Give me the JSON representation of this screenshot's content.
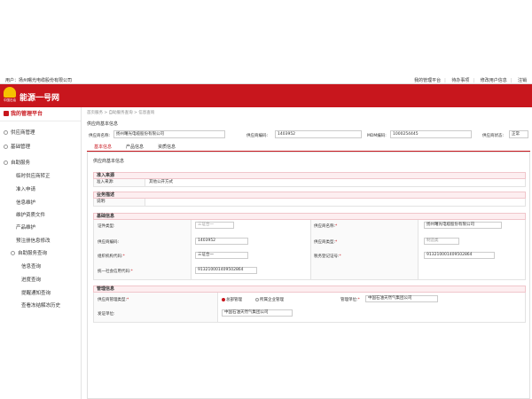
{
  "topbar": {
    "user_label": "用户：扬州曙光电缆股份有限公司",
    "links": [
      "我的管理平台",
      "待办事项",
      "修改用户信息",
      "注销"
    ]
  },
  "header": {
    "title": "能源一号网",
    "logo_caption": "中国石油"
  },
  "sidebar": {
    "title": "我的管理平台",
    "items": [
      {
        "label": "供应商管理"
      },
      {
        "label": "基础管理"
      },
      {
        "label": "自助服务"
      },
      {
        "label": "临时供应商转正"
      },
      {
        "label": "准入申请"
      },
      {
        "label": "信息维护"
      },
      {
        "label": "维护资质文件"
      },
      {
        "label": "产品维护"
      },
      {
        "label": "预注册信息修改"
      },
      {
        "label": "自助服务查询"
      },
      {
        "label": "信息查询"
      },
      {
        "label": "进度查询"
      },
      {
        "label": "提醒通知查询"
      },
      {
        "label": "查看冻结解冻历史"
      }
    ]
  },
  "main": {
    "breadcrumb": "首页服务 > 自助服务查询 > 信息查询",
    "section_title": "供应商基本信息",
    "info": {
      "name_label": "供应商名称:",
      "name_value": "扬州曙光电缆股份有限公司",
      "code_label": "供应商编码:",
      "code_value": "1403952",
      "mdm_label": "MDM编码:",
      "mdm_value": "1000254445",
      "status_label": "供应商状态:",
      "status_value": "正常"
    },
    "tabs": [
      "基本信息",
      "产品信息",
      "资质信息"
    ],
    "panel_title": "供应商基本信息",
    "access": {
      "title": "准入来源",
      "label": "准入来源:",
      "value": "其他公开方式"
    },
    "business": {
      "title": "业务描述",
      "label": "说明:"
    },
    "basic": {
      "title": "基础信息",
      "rows": [
        {
          "l1": "证件类型:",
          "v1": "三证合一",
          "l2": "供应商名称:",
          "v2": "扬州曙光电缆股份有限公司"
        },
        {
          "l1": "供应商编码:",
          "v1": "1403952",
          "l2": "供应商类型:",
          "v2": "制造类"
        },
        {
          "l1": "组织机构代码:",
          "v1": "三证合一",
          "l2": "税务登记证号:",
          "v2": "913210001409502864"
        },
        {
          "l1": "统一社会信用代码:",
          "v1": "913210001409502864",
          "l2": "",
          "v2": ""
        }
      ]
    },
    "mgmt": {
      "title": "管理信息",
      "type_label": "供应商管理类型:",
      "radio1": "总部管理",
      "radio2": "所属企业管理",
      "unit_label": "管理单位:",
      "unit_value": "中国石油天然气集团公司",
      "issuer_label": "发证单位:",
      "issuer_value": "中国石油天然气集团公司"
    }
  }
}
